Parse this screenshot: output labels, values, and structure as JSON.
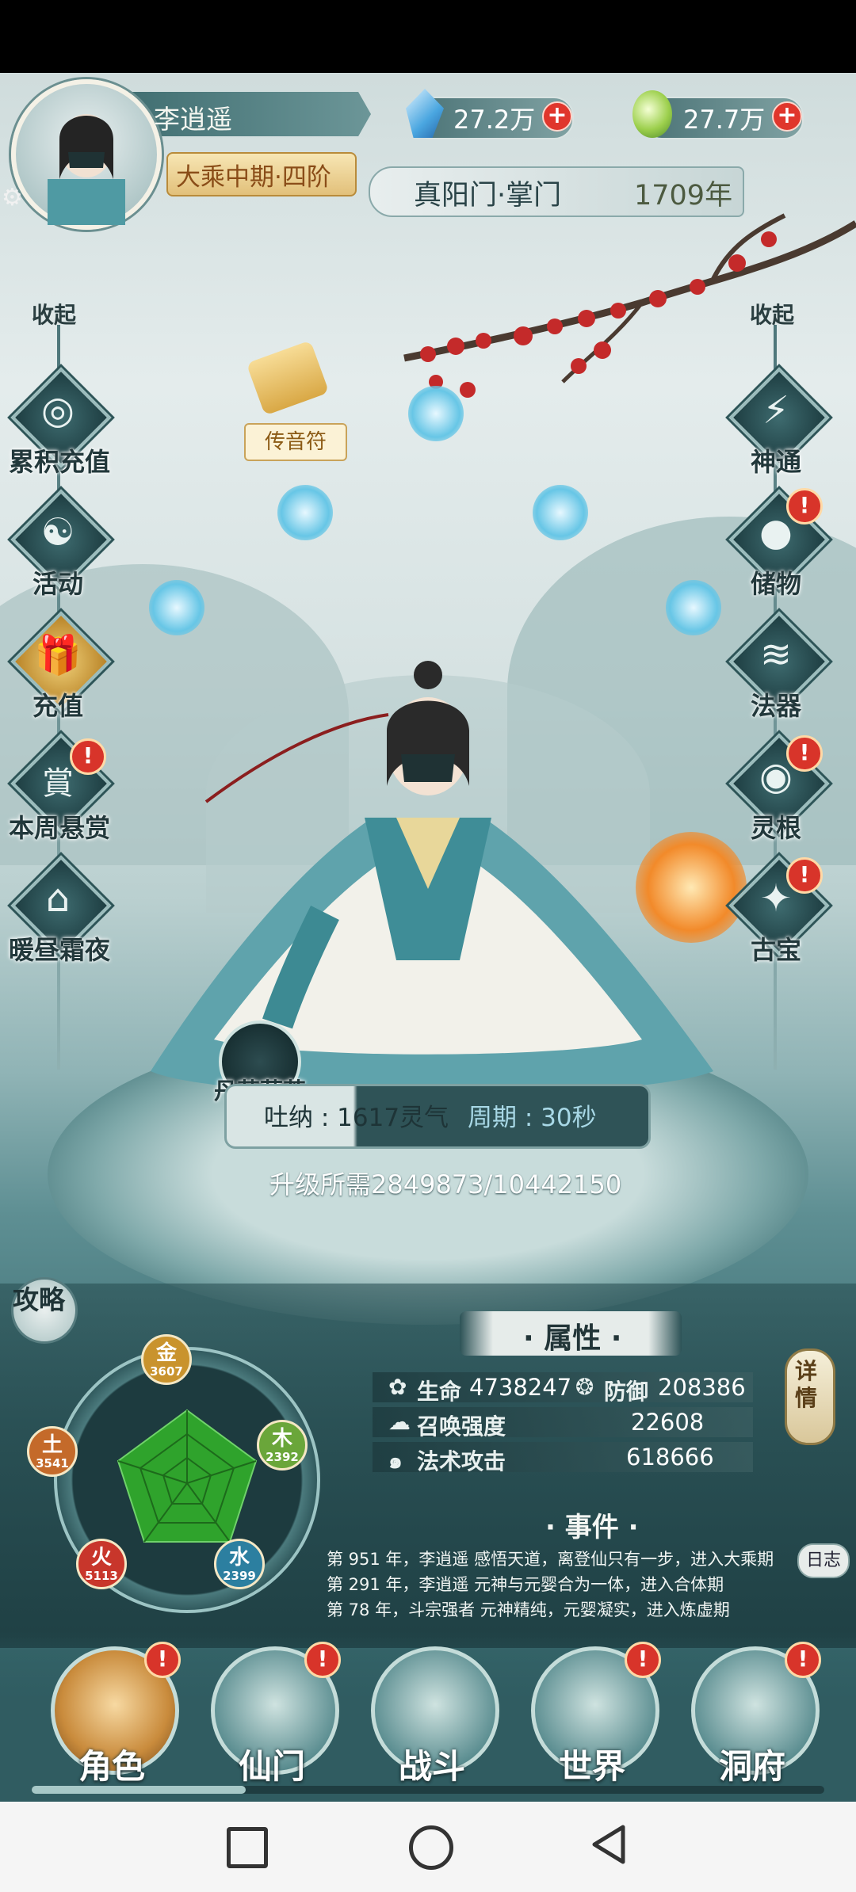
{
  "player": {
    "name": "李逍遥",
    "realm": "大乘中期·四阶",
    "sect": "真阳门·掌门",
    "age": "1709年"
  },
  "resources": {
    "spirit_stone": "27.2万",
    "jade": "27.7万",
    "plus": "+"
  },
  "left_menu": {
    "collapse": "收起",
    "items": [
      {
        "label": "累积充值",
        "icon": "coin-plus-icon",
        "glyph": "◎"
      },
      {
        "label": "活动",
        "icon": "taiji-icon",
        "glyph": "☯"
      },
      {
        "label": "充值",
        "icon": "gift-icon",
        "glyph": "🎁"
      },
      {
        "label": "本周悬赏",
        "icon": "bounty-icon",
        "glyph": "賞"
      },
      {
        "label": "暖昼霜夜",
        "icon": "house-icon",
        "glyph": "⌂"
      }
    ]
  },
  "right_menu": {
    "collapse": "收起",
    "items": [
      {
        "label": "神通",
        "icon": "skill-icon",
        "glyph": "⚡"
      },
      {
        "label": "储物",
        "icon": "bag-icon",
        "glyph": "●"
      },
      {
        "label": "法器",
        "icon": "artifact-icon",
        "glyph": "≋"
      },
      {
        "label": "灵根",
        "icon": "root-icon",
        "glyph": "◉"
      },
      {
        "label": "古宝",
        "icon": "treasure-icon",
        "glyph": "✦"
      }
    ]
  },
  "scene": {
    "scroll_label": "传音符",
    "gourd_label": "丹药葫芦"
  },
  "cultivation": {
    "breath": "吐纳 : 1617灵气",
    "cycle": "周期 : 30秒",
    "upgrade": "升级所需2849873/10442150"
  },
  "guide": "攻略",
  "elements": [
    {
      "name": "金",
      "value": "3607",
      "color": "#c9932d"
    },
    {
      "name": "木",
      "value": "2392",
      "color": "#6aa63a"
    },
    {
      "name": "水",
      "value": "2399",
      "color": "#2c7fa0"
    },
    {
      "name": "火",
      "value": "5113",
      "color": "#c8362b"
    },
    {
      "name": "土",
      "value": "3541",
      "color": "#c46a2a"
    }
  ],
  "attributes": {
    "title": "· 属性 ·",
    "hp_label": "生命",
    "hp": "4738247",
    "def_label": "防御",
    "def": "208386",
    "summon_label": "召唤强度",
    "summon": "22608",
    "spell_label": "法术攻击",
    "spell": "618666",
    "detail": "详情"
  },
  "events": {
    "title": "· 事件 ·",
    "log": "日志",
    "lines": [
      "第 951 年，李逍遥 感悟天道，离登仙只有一步，进入大乘期",
      "第 291 年，李逍遥 元神与元婴合为一体，进入合体期",
      "第 78 年，斗宗强者 元神精纯，元婴凝实，进入炼虚期"
    ]
  },
  "bottom_nav": [
    {
      "label": "角色"
    },
    {
      "label": "仙门"
    },
    {
      "label": "战斗"
    },
    {
      "label": "世界"
    },
    {
      "label": "洞府"
    }
  ],
  "alert_mark": "!",
  "colors": {
    "accent": "#3e6f74",
    "badge": "#d8342a",
    "gold": "#e2c07a"
  }
}
